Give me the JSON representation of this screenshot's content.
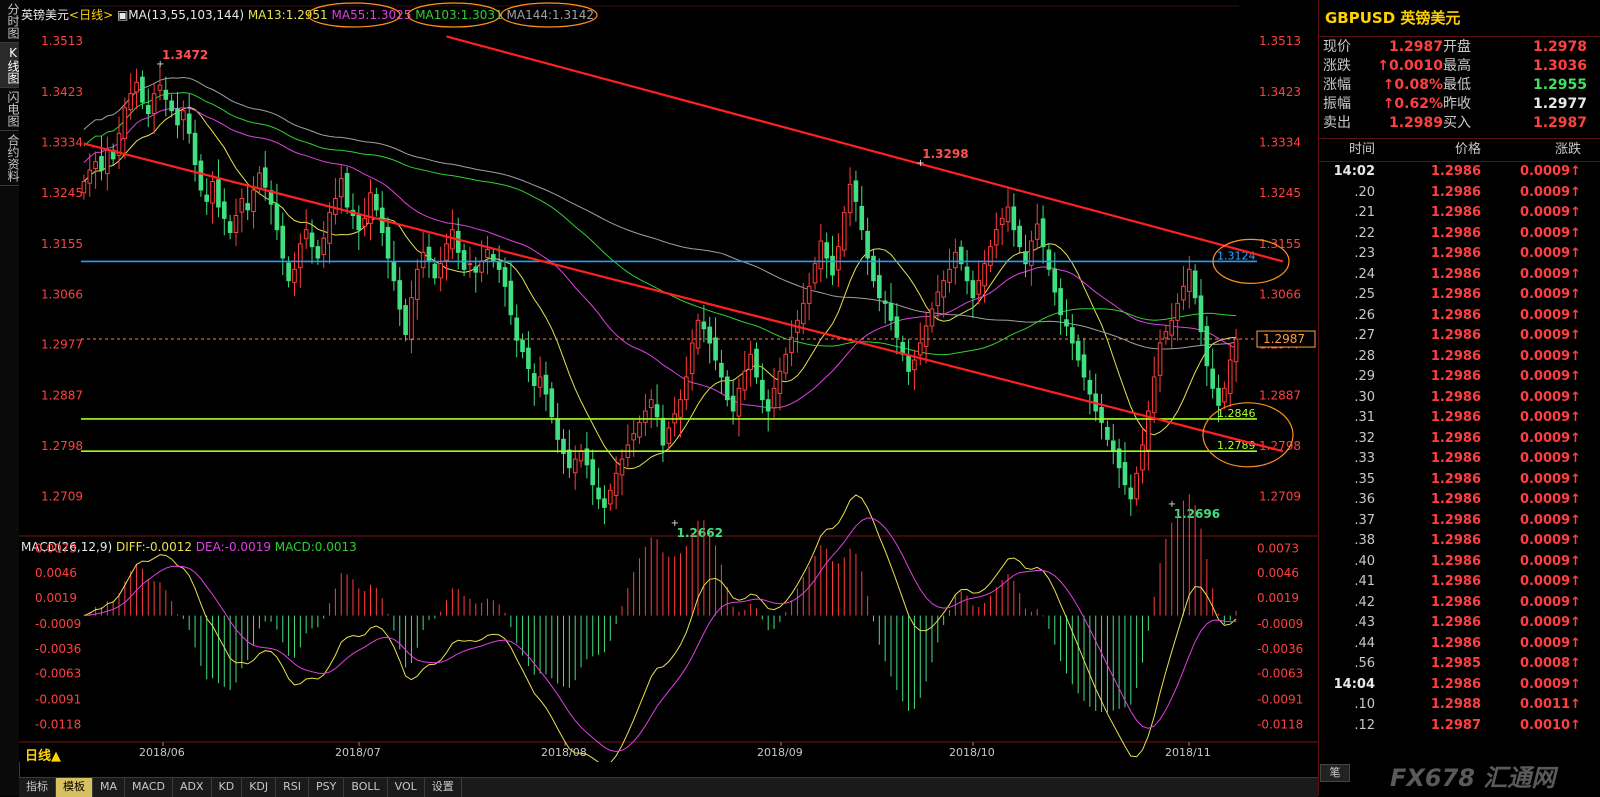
{
  "left_rail": [
    "分时图",
    "K线图",
    "闪电图",
    "合约资料"
  ],
  "header": {
    "symbol": "英镑美元",
    "period": "<日线>",
    "ma_title": "MA(13,55,103,144)",
    "ma13": "MA13:1.2951",
    "ma55": "MA55:1.3025",
    "ma103": "MA103:1.3031",
    "ma144": "MA144:1.3142"
  },
  "macd_header": {
    "title": "MACD(26,12,9)",
    "diff": "DIFF:-0.0012",
    "dea": "DEA:-0.0019",
    "macd": "MACD:0.0013"
  },
  "colors": {
    "bull": "#ff3c3c",
    "bear": "#40e080",
    "ma13": "#e8e050",
    "ma55": "#e040e0",
    "ma103": "#30d030",
    "ma144": "#a0a0a0",
    "trend": "#ff2020",
    "hline": "#20a0ff",
    "support": "#a0ff20"
  },
  "chart_data": [
    {
      "type": "candlestick",
      "title": "英镑美元<日线>",
      "x_labels": [
        "2018/06",
        "2018/07",
        "2018/08",
        "2018/09",
        "2018/10",
        "2018/11"
      ],
      "ylim": [
        1.265,
        1.355
      ],
      "y_ticks": [
        "1.3513",
        "1.3423",
        "1.3334",
        "1.3245",
        "1.3155",
        "1.3066",
        "1.2977",
        "1.2887",
        "1.2798",
        "1.2709"
      ],
      "annotations": [
        {
          "text": "1.3472",
          "value": 1.3472,
          "bar": 13
        },
        {
          "text": "1.2662",
          "value": 1.2662,
          "bar": 101
        },
        {
          "text": "1.3298",
          "value": 1.3298,
          "bar": 143
        },
        {
          "text": "1.2696",
          "value": 1.2696,
          "bar": 186
        }
      ],
      "levels": [
        {
          "text": "1.3124",
          "value": 1.3124,
          "kind": "resistance"
        },
        {
          "text": "1.2846",
          "value": 1.2846,
          "kind": "support"
        },
        {
          "text": "1.2789",
          "value": 1.2789,
          "kind": "support"
        }
      ],
      "last_price": "1.2987",
      "last_price_value": 1.2987,
      "trend_lines": [
        {
          "from_bar": 0,
          "from": 1.3332,
          "to_bar": 205,
          "to": 1.2789
        },
        {
          "from_bar": 62,
          "from": 1.3521,
          "to_bar": 205,
          "to": 1.3124
        }
      ],
      "closes": [
        1.3265,
        1.3285,
        1.33,
        1.3285,
        1.332,
        1.3305,
        1.335,
        1.3395,
        1.342,
        1.344,
        1.3405,
        1.3385,
        1.342,
        1.3435,
        1.341,
        1.339,
        1.3365,
        1.339,
        1.335,
        1.3295,
        1.325,
        1.323,
        1.3265,
        1.322,
        1.32,
        1.3175,
        1.3205,
        1.3235,
        1.3215,
        1.325,
        1.328,
        1.3255,
        1.3225,
        1.318,
        1.313,
        1.309,
        1.311,
        1.3155,
        1.318,
        1.315,
        1.313,
        1.3165,
        1.321,
        1.3235,
        1.327,
        1.322,
        1.3205,
        1.318,
        1.32,
        1.3245,
        1.3215,
        1.3175,
        1.313,
        1.309,
        1.304,
        1.2995,
        1.306,
        1.311,
        1.314,
        1.3125,
        1.3095,
        1.312,
        1.3155,
        1.318,
        1.314,
        1.311,
        1.312,
        1.3105,
        1.3125,
        1.3145,
        1.3125,
        1.311,
        1.308,
        1.303,
        1.2985,
        1.2965,
        1.2935,
        1.2905,
        1.292,
        1.289,
        1.285,
        1.281,
        1.2785,
        1.276,
        1.2775,
        1.279,
        1.2765,
        1.273,
        1.2705,
        1.269,
        1.272,
        1.275,
        1.2775,
        1.28,
        1.282,
        1.284,
        1.286,
        1.288,
        1.285,
        1.28,
        1.283,
        1.2855,
        1.288,
        1.292,
        1.298,
        1.302,
        1.3005,
        1.298,
        1.295,
        1.292,
        1.288,
        1.286,
        1.29,
        1.293,
        1.296,
        1.292,
        1.288,
        1.286,
        1.29,
        1.293,
        1.296,
        1.299,
        1.302,
        1.305,
        1.308,
        1.312,
        1.316,
        1.313,
        1.31,
        1.315,
        1.321,
        1.326,
        1.323,
        1.318,
        1.313,
        1.309,
        1.306,
        1.305,
        1.302,
        1.299,
        1.296,
        1.293,
        1.295,
        1.298,
        1.301,
        1.304,
        1.307,
        1.309,
        1.311,
        1.314,
        1.312,
        1.309,
        1.306,
        1.309,
        1.312,
        1.315,
        1.318,
        1.32,
        1.322,
        1.318,
        1.315,
        1.312,
        1.316,
        1.319,
        1.315,
        1.311,
        1.307,
        1.303,
        1.301,
        1.298,
        1.295,
        1.292,
        1.289,
        1.286,
        1.284,
        1.281,
        1.279,
        1.276,
        1.273,
        1.2705,
        1.275,
        1.28,
        1.286,
        1.292,
        1.298,
        1.3,
        1.302,
        1.305,
        1.308,
        1.311,
        1.306,
        1.3,
        1.294,
        1.29,
        1.287,
        1.29,
        1.295,
        1.2987
      ],
      "ma_labels": [
        "MA13:1.2951",
        "MA55:1.3025",
        "MA103:1.3031",
        "MA144:1.3142"
      ]
    },
    {
      "type": "macd",
      "title": "MACD(26,12,9)",
      "ylim": [
        -0.0135,
        0.0082
      ],
      "y_ticks": [
        "0.0073",
        "0.0046",
        "0.0019",
        "-0.0009",
        "-0.0036",
        "-0.0063",
        "-0.0091",
        "-0.0118"
      ],
      "diff_last": -0.0012,
      "dea_last": -0.0019,
      "macd_last": 0.0013
    }
  ],
  "quote": {
    "title": "GBPUSD 英镑美元",
    "rows": [
      [
        "现价",
        "1.2987",
        "开盘",
        "1.2978"
      ],
      [
        "涨跌",
        "↑0.0010",
        "最高",
        "1.3036"
      ],
      [
        "涨幅",
        "↑0.08%",
        "最低",
        "1.2955"
      ],
      [
        "振幅",
        "↑0.62%",
        "昨收",
        "1.2977"
      ],
      [
        "卖出",
        "1.2989",
        "买入",
        "1.2987"
      ]
    ],
    "ticks_head": [
      "时间",
      "价格",
      "涨跌"
    ],
    "ticks": [
      [
        "14:02",
        "1.2986",
        "0.0009↑"
      ],
      [
        ".20",
        "1.2986",
        "0.0009↑"
      ],
      [
        ".21",
        "1.2986",
        "0.0009↑"
      ],
      [
        ".22",
        "1.2986",
        "0.0009↑"
      ],
      [
        ".23",
        "1.2986",
        "0.0009↑"
      ],
      [
        ".24",
        "1.2986",
        "0.0009↑"
      ],
      [
        ".25",
        "1.2986",
        "0.0009↑"
      ],
      [
        ".26",
        "1.2986",
        "0.0009↑"
      ],
      [
        ".27",
        "1.2986",
        "0.0009↑"
      ],
      [
        ".28",
        "1.2986",
        "0.0009↑"
      ],
      [
        ".29",
        "1.2986",
        "0.0009↑"
      ],
      [
        ".30",
        "1.2986",
        "0.0009↑"
      ],
      [
        ".31",
        "1.2986",
        "0.0009↑"
      ],
      [
        ".32",
        "1.2986",
        "0.0009↑"
      ],
      [
        ".33",
        "1.2986",
        "0.0009↑"
      ],
      [
        ".35",
        "1.2986",
        "0.0009↑"
      ],
      [
        ".36",
        "1.2986",
        "0.0009↑"
      ],
      [
        ".37",
        "1.2986",
        "0.0009↑"
      ],
      [
        ".38",
        "1.2986",
        "0.0009↑"
      ],
      [
        ".40",
        "1.2986",
        "0.0009↑"
      ],
      [
        ".41",
        "1.2986",
        "0.0009↑"
      ],
      [
        ".42",
        "1.2986",
        "0.0009↑"
      ],
      [
        ".43",
        "1.2986",
        "0.0009↑"
      ],
      [
        ".44",
        "1.2986",
        "0.0009↑"
      ],
      [
        ".56",
        "1.2985",
        "0.0008↑"
      ],
      [
        "14:04",
        "1.2986",
        "0.0009↑"
      ],
      [
        ".10",
        "1.2988",
        "0.0011↑"
      ],
      [
        ".12",
        "1.2987",
        "0.0010↑"
      ]
    ]
  },
  "bottom": {
    "period_label": "日线▲",
    "tabs": [
      "指标",
      "模板",
      "MA",
      "MACD",
      "ADX",
      "KD",
      "KDJ",
      "RSI",
      "PSY",
      "BOLL",
      "VOL",
      "设置"
    ],
    "side_button": "笔",
    "watermark": "FX678 汇通网"
  }
}
